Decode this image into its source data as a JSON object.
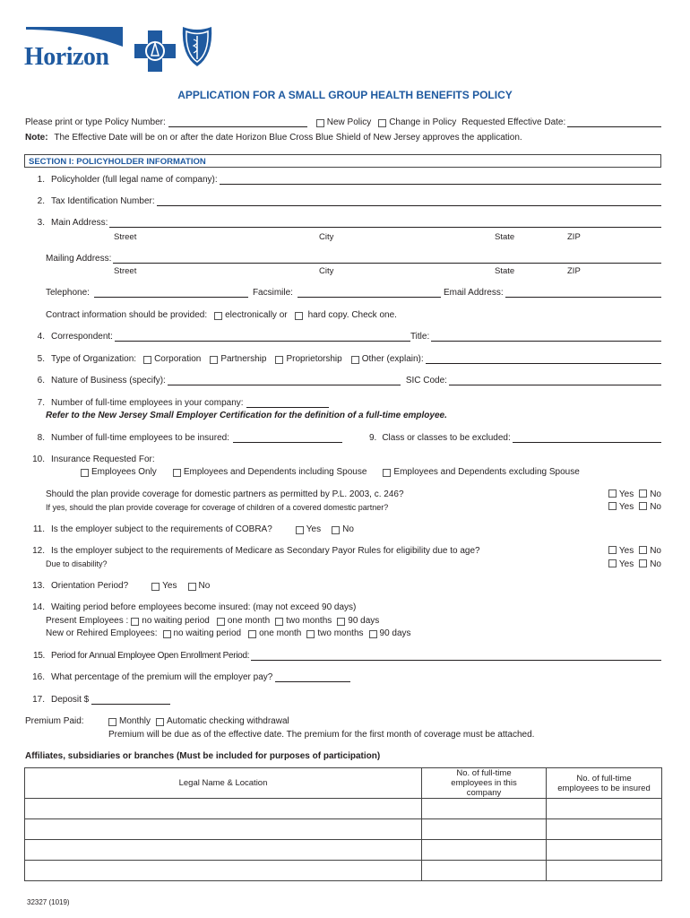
{
  "logo": {
    "brand": "Horizon",
    "icons": [
      "blue-cross-icon",
      "blue-shield-icon"
    ],
    "brand_color": "#1f5aa0"
  },
  "title": "APPLICATION FOR A SMALL GROUP HEALTH BENEFITS POLICY",
  "header": {
    "policy_number_label": "Please print or type Policy Number:",
    "new_policy": "New Policy",
    "change_policy": "Change in Policy",
    "effective_date_label": "Requested Effective Date:",
    "note_label": "Note:",
    "note_text": "The Effective Date will be on or after the date Horizon Blue Cross Blue Shield of New Jersey approves the application."
  },
  "section1": {
    "title": "SECTION I:  POLICYHOLDER INFORMATION",
    "q1": {
      "num": "1.",
      "label": "Policyholder (full legal name of company):"
    },
    "q2": {
      "num": "2.",
      "label": "Tax Identification Number:"
    },
    "q3": {
      "num": "3.",
      "label": "Main Address:"
    },
    "address_parts": {
      "street": "Street",
      "city": "City",
      "state": "State",
      "zip": "ZIP"
    },
    "mailing_label": "Mailing Address:",
    "telephone_label": "Telephone:",
    "fax_label": "Facsimile:",
    "email_label": "Email Address:",
    "contract_label": "Contract information should be provided:",
    "contract_opt1": "electronically or",
    "contract_opt2": "hard copy.  Check one.",
    "q4": {
      "num": "4.",
      "label": "Correspondent:",
      "title_label": "Title:"
    },
    "q5": {
      "num": "5.",
      "label": "Type of Organization:",
      "options": [
        "Corporation",
        "Partnership",
        "Proprietorship",
        "Other (explain):"
      ]
    },
    "q6": {
      "num": "6.",
      "label": "Nature of Business (specify):",
      "sic_label": "SIC Code:"
    },
    "q7": {
      "num": "7.",
      "label": "Number of full-time employees in your company:",
      "note": "Refer to the New Jersey Small Employer Certification for the definition of a full-time employee."
    },
    "q8": {
      "num": "8.",
      "label": "Number of full-time employees to be insured:"
    },
    "q9": {
      "num": "9.",
      "label": "Class or classes to be excluded:"
    },
    "q10": {
      "num": "10.",
      "label": "Insurance Requested For:",
      "options": [
        "Employees Only",
        "Employees and Dependents including Spouse",
        "Employees and Dependents excluding Spouse"
      ],
      "dp_question": "Should the plan provide coverage for domestic partners as permitted by P.L. 2003, c. 246?",
      "dp_children": "If yes, should the plan provide coverage for coverage of children of a covered domestic partner?"
    },
    "q11": {
      "num": "11.",
      "label": "Is the employer subject to the requirements of COBRA?"
    },
    "q12": {
      "num": "12.",
      "label": "Is the employer subject to the requirements of Medicare as Secondary Payor Rules for eligibility due to age?",
      "sub": "Due to disability?"
    },
    "q13": {
      "num": "13.",
      "label": "Orientation Period?"
    },
    "q14": {
      "num": "14.",
      "label": "Waiting period before employees become insured: (may not exceed 90 days)",
      "present_label": "Present Employees :",
      "new_label": "New or Rehired Employees:",
      "options": [
        "no waiting period",
        "one month",
        "two months",
        "90 days"
      ]
    },
    "q15": {
      "num": "15.",
      "label": "Period for Annual Employee Open Enrollment Period:"
    },
    "q16": {
      "num": "16.",
      "label": "What percentage of the premium will the employer pay?"
    },
    "q17": {
      "num": "17.",
      "label": "Deposit $"
    },
    "premium": {
      "label": "Premium Paid:",
      "options": [
        "Monthly",
        "Automatic checking withdrawal"
      ],
      "note": "Premium will be due as of the effective date.  The premium for the first month of coverage must be attached."
    },
    "yes": "Yes",
    "no": "No"
  },
  "affiliates": {
    "title": "Affiliates, subsidiaries or branches (Must be included for purposes of participation)",
    "columns": [
      "Legal Name & Location",
      "No. of full-time employees in this company",
      "No. of full-time employees to be insured"
    ],
    "rows": [
      [
        "",
        "",
        ""
      ],
      [
        "",
        "",
        ""
      ],
      [
        "",
        "",
        ""
      ],
      [
        "",
        "",
        ""
      ]
    ]
  },
  "footer": {
    "form_code": "32327 (1019)"
  }
}
